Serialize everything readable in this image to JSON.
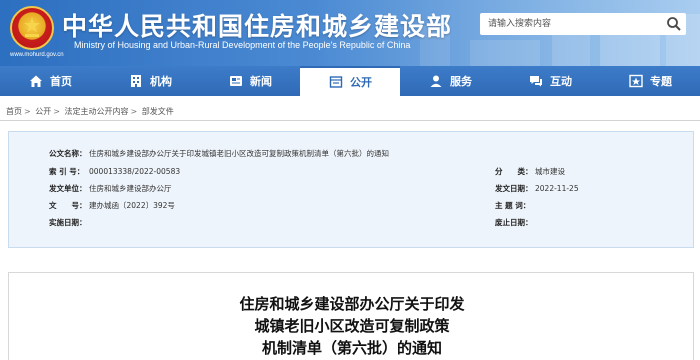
{
  "header": {
    "title": "中华人民共和国住房和城乡建设部",
    "subtitle": "Ministry of Housing and Urban-Rural Development of the People's Republic of China",
    "url": "www.mohurd.gov.cn",
    "emblem_icon": "national-emblem-icon"
  },
  "search": {
    "placeholder": "请输入搜索内容",
    "icon": "search-icon"
  },
  "nav": {
    "items": [
      {
        "label": "首页",
        "icon": "home-icon"
      },
      {
        "label": "机构",
        "icon": "building-icon"
      },
      {
        "label": "新闻",
        "icon": "news-icon"
      },
      {
        "label": "公开",
        "icon": "disclosure-icon"
      },
      {
        "label": "服务",
        "icon": "service-icon"
      },
      {
        "label": "互动",
        "icon": "chat-icon"
      },
      {
        "label": "专题",
        "icon": "topic-icon"
      }
    ],
    "active_index": 3
  },
  "breadcrumb": [
    "首页",
    "公开",
    "法定主动公开内容",
    "部发文件"
  ],
  "info": {
    "title_label": "公文名称：",
    "title_value": "住房和城乡建设部办公厅关于印发城镇老旧小区改造可复制政策机制清单（第六批）的通知",
    "index_label": "索  引  号：",
    "index_value": "000013338/2022-00583",
    "category_label": "分　　类：",
    "category_value": "城市建设",
    "issuer_label": "发文单位：",
    "issuer_value": "住房和城乡建设部办公厅",
    "date_label": "发文日期：",
    "date_value": "2022-11-25",
    "docno_label": "文　　号：",
    "docno_value": "建办城函〔2022〕392号",
    "subject_label": "主 题 词：",
    "subject_value": "",
    "effective_label": "实施日期：",
    "effective_value": "",
    "expire_label": "废止日期：",
    "expire_value": ""
  },
  "article": {
    "title_line1": "住房和城乡建设部办公厅关于印发",
    "title_line2": "城镇老旧小区改造可复制政策",
    "title_line3": "机制清单（第六批）的通知"
  },
  "colors": {
    "nav_bg": "#2f6ab6",
    "header_bg": "#3d7cc9",
    "panel_bg": "#eef4fb"
  }
}
